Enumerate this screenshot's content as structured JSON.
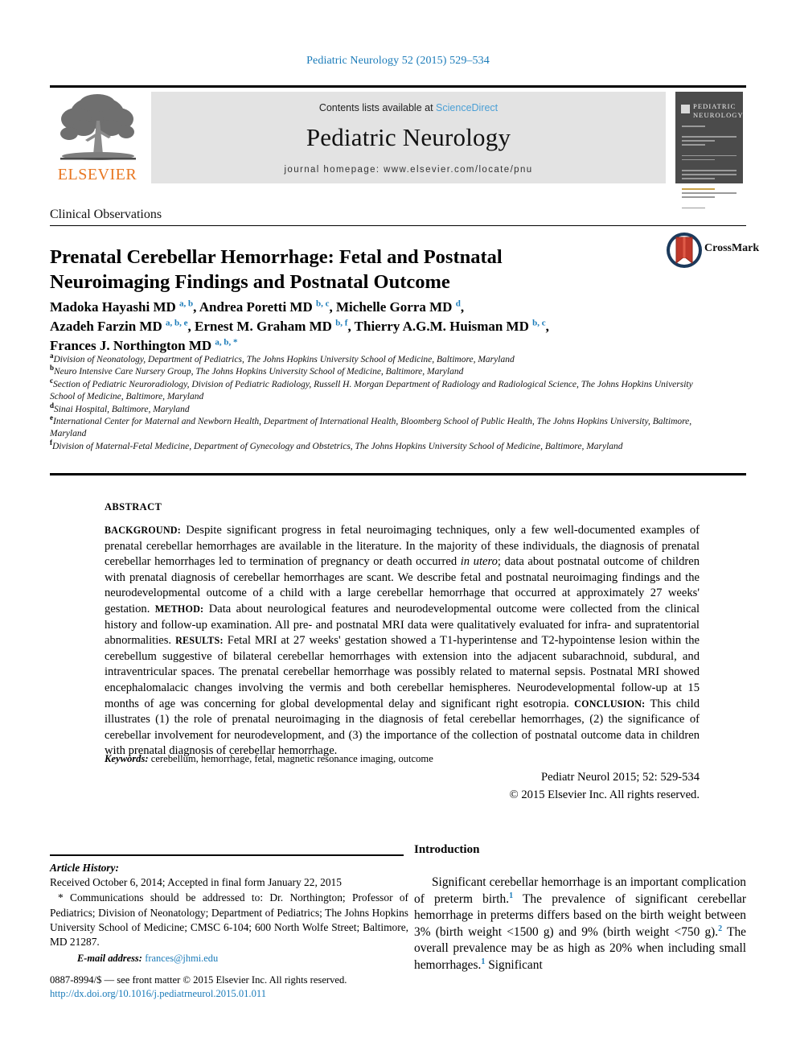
{
  "running_head": "Pediatric Neurology 52 (2015) 529–534",
  "masthead": {
    "publisher_name": "ELSEVIER",
    "contents_prefix": "Contents lists available at",
    "sciencedirect_link": "ScienceDirect",
    "journal_name": "Pediatric Neurology",
    "homepage_line": "journal homepage: www.elsevier.com/locate/pnu",
    "cover_title_line1": "PEDIATRIC",
    "cover_title_line2": "NEUROLOGY"
  },
  "article": {
    "section_label": "Clinical Observations",
    "title": "Prenatal Cerebellar Hemorrhage: Fetal and Postnatal Neuroimaging Findings and Postnatal Outcome",
    "crossmark_label": "CrossMark",
    "authors_html": "Madoka Hayashi MD <sup>a, b</sup>, Andrea Poretti MD <sup>b, c</sup>, Michelle Gorra MD <sup>d</sup>,<br>Azadeh Farzin MD <sup>a, b, e</sup>, Ernest M. Graham MD <sup>b, f</sup>, Thierry A.G.M. Huisman MD <sup>b, c</sup>,<br>Frances J. Northington MD <sup>a, b, *</sup>",
    "affiliations": [
      {
        "marker": "a",
        "text": "Division of Neonatology, Department of Pediatrics, The Johns Hopkins University School of Medicine, Baltimore, Maryland"
      },
      {
        "marker": "b",
        "text": "Neuro Intensive Care Nursery Group, The Johns Hopkins University School of Medicine, Baltimore, Maryland"
      },
      {
        "marker": "c",
        "text": "Section of Pediatric Neuroradiology, Division of Pediatric Radiology, Russell H. Morgan Department of Radiology and Radiological Science, The Johns Hopkins University School of Medicine, Baltimore, Maryland"
      },
      {
        "marker": "d",
        "text": "Sinai Hospital, Baltimore, Maryland"
      },
      {
        "marker": "e",
        "text": "International Center for Maternal and Newborn Health, Department of International Health, Bloomberg School of Public Health, The Johns Hopkins University, Baltimore, Maryland"
      },
      {
        "marker": "f",
        "text": "Division of Maternal-Fetal Medicine, Department of Gynecology and Obstetrics, The Johns Hopkins University School of Medicine, Baltimore, Maryland"
      }
    ]
  },
  "abstract": {
    "heading": "ABSTRACT",
    "background_label": "BACKGROUND:",
    "background_text": "Despite significant progress in fetal neuroimaging techniques, only a few well-documented examples of prenatal cerebellar hemorrhages are available in the literature. In the majority of these individuals, the diagnosis of prenatal cerebellar hemorrhages led to termination of pregnancy or death occurred in utero; data about postnatal outcome of children with prenatal diagnosis of cerebellar hemorrhages are scant. We describe fetal and postnatal neuroimaging findings and the neurodevelopmental outcome of a child with a large cerebellar hemorrhage that occurred at approximately 27 weeks' gestation.",
    "method_label": "METHOD:",
    "method_text": "Data about neurological features and neurodevelopmental outcome were collected from the clinical history and follow-up examination. All pre- and postnatal MRI data were qualitatively evaluated for infra- and supratentorial abnormalities.",
    "results_label": "RESULTS:",
    "results_text": "Fetal MRI at 27 weeks' gestation showed a T1-hyperintense and T2-hypointense lesion within the cerebellum suggestive of bilateral cerebellar hemorrhages with extension into the adjacent subarachnoid, subdural, and intraventricular spaces. The prenatal cerebellar hemorrhage was possibly related to maternal sepsis. Postnatal MRI showed encephalomalacic changes involving the vermis and both cerebellar hemispheres. Neurodevelopmental follow-up at 15 months of age was concerning for global developmental delay and significant right esotropia.",
    "conclusion_label": "CONCLUSION:",
    "conclusion_text": "This child illustrates (1) the role of prenatal neuroimaging in the diagnosis of fetal cerebellar hemorrhages, (2) the significance of cerebellar involvement for neurodevelopment, and (3) the importance of the collection of postnatal outcome data in children with prenatal diagnosis of cerebellar hemorrhage.",
    "keywords_label": "Keywords:",
    "keywords_value": "cerebellum, hemorrhage, fetal, magnetic resonance imaging, outcome",
    "citation": "Pediatr Neurol 2015; 52: 529-534",
    "copyright": "© 2015 Elsevier Inc. All rights reserved."
  },
  "article_history": {
    "title": "Article History:",
    "received": "Received October 6, 2014; Accepted in final form January 22, 2015",
    "correspondence": "* Communications should be addressed to: Dr. Northington; Professor of Pediatrics; Division of Neonatology; Department of Pediatrics; The Johns Hopkins University School of Medicine; CMSC 6-104; 600 North Wolfe Street; Baltimore, MD 21287.",
    "email_label": "E-mail address:",
    "email_value": "frances@jhmi.edu"
  },
  "footer": {
    "issn_line": "0887-8994/$ — see front matter © 2015 Elsevier Inc. All rights reserved.",
    "doi": "http://dx.doi.org/10.1016/j.pediatrneurol.2015.01.011"
  },
  "introduction": {
    "heading": "Introduction",
    "paragraph_html": "Significant cerebellar hemorrhage is an important complication of preterm birth.<sup>1</sup> The prevalence of significant cerebellar hemorrhage in preterms differs based on the birth weight between 3% (birth weight &lt;1500 g) and 9% (birth weight &lt;750 g).<sup>2</sup> The overall prevalence may be as high as 20% when including small hemorrhages.<sup>1</sup> Significant"
  },
  "colors": {
    "link_blue": "#1a7bb9",
    "sciencedirect_blue": "#4a9fd5",
    "elsevier_orange": "#E87722",
    "band_gray": "#e3e3e3",
    "cover_gray": "#4b4b4b"
  }
}
